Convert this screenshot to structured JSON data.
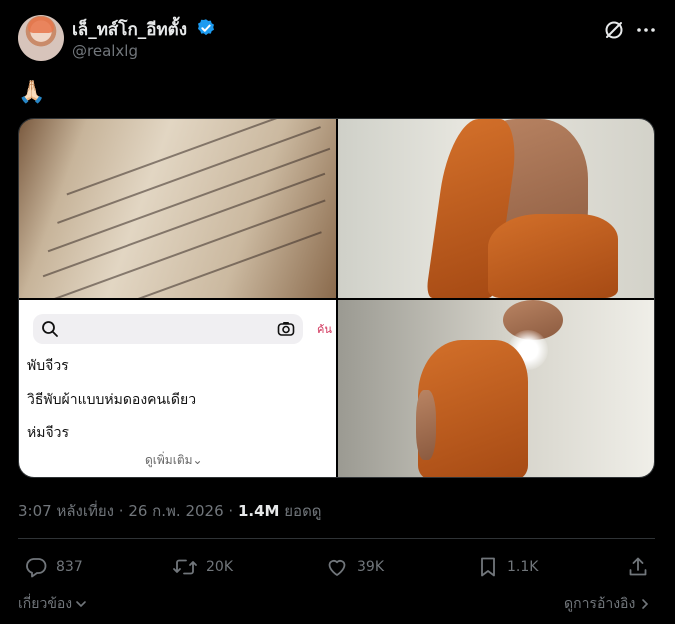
{
  "author": {
    "display_name": "เล็_ทส์โก_อีทตั้ง",
    "handle": "@realxlg",
    "verified": true
  },
  "header_icons": [
    "grok-icon",
    "more-options-icon"
  ],
  "tweet_text": "🙏🏻",
  "media": {
    "search_panel": {
      "search_placeholder": "",
      "cut_text": "ค้น",
      "suggestions": [
        "พับจีวร",
        "วิธีพับผ้าแบบห่มดองคนเดียว",
        "ห่มจีวร"
      ],
      "see_more": "ดูเพิ่มเติม"
    }
  },
  "meta": {
    "time": "3:07 หลังเที่ยง",
    "sep1": "·",
    "date": "26 ก.พ. 2026",
    "sep2": "·",
    "views": "1.4M",
    "views_label": "ยอดดู"
  },
  "actions": {
    "replies": "837",
    "reposts": "20K",
    "likes": "39K",
    "bookmarks": "1.1K"
  },
  "footer": {
    "related": "เกี่ยวข้อง",
    "view_quotes": "ดูการอ้างอิง"
  },
  "colors": {
    "background": "#000000",
    "text": "#e7e9ea",
    "secondary": "#71767b",
    "verified": "#1d9bf0",
    "border": "#2f3336"
  }
}
